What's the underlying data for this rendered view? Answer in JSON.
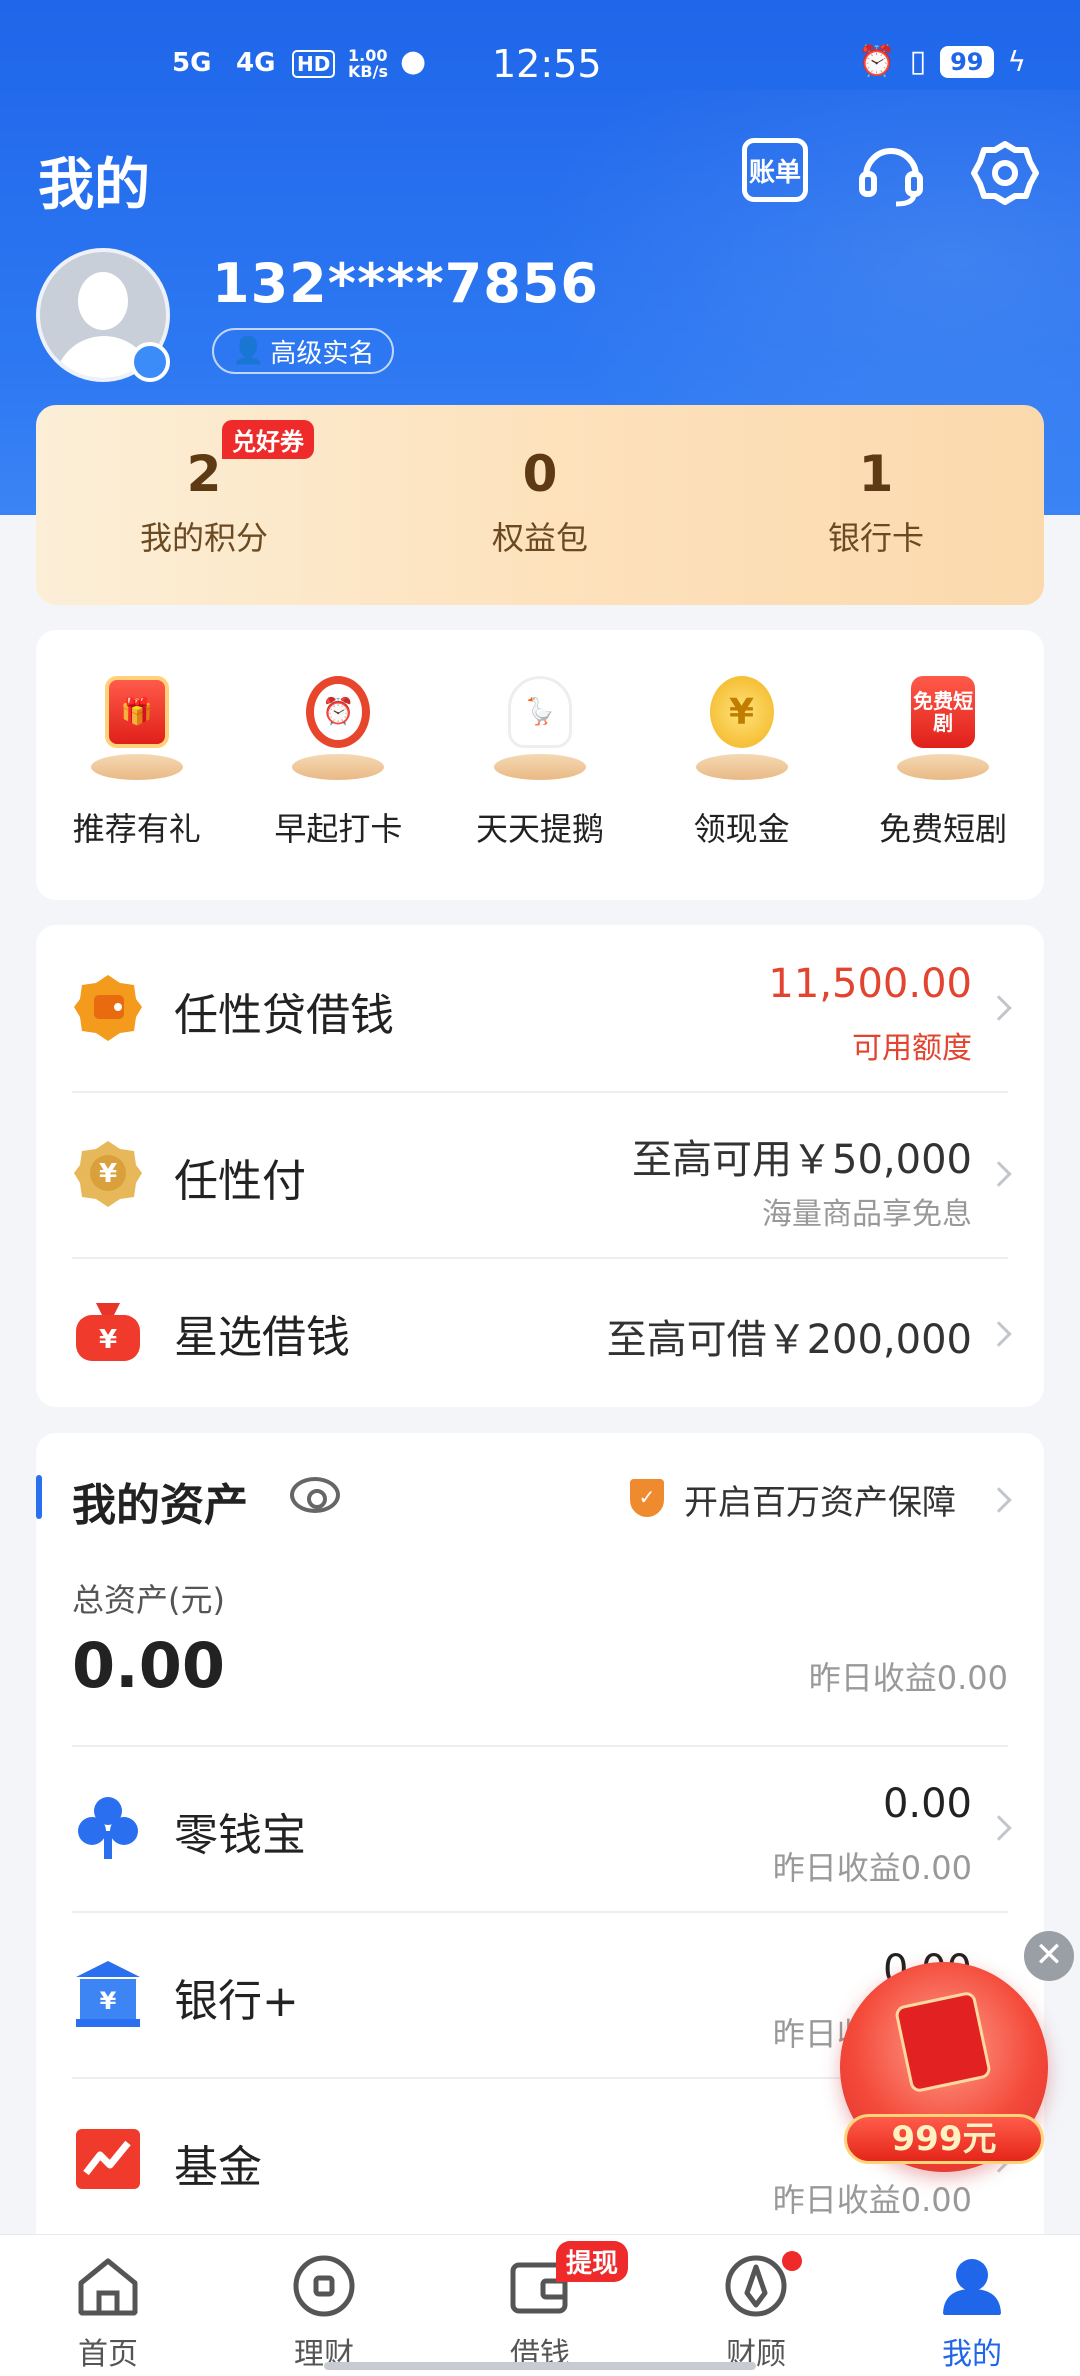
{
  "status_bar": {
    "net1": "5G",
    "net2": "4G",
    "hd": "HD",
    "speed": "1.00 KB/s",
    "time": "12:55",
    "battery": "99"
  },
  "header": {
    "title": "我的",
    "bill_label": "账单"
  },
  "profile": {
    "phone": "132****7856",
    "realname_badge": "高级实名"
  },
  "points_card": {
    "coupon_tag": "兑好券",
    "items": [
      {
        "value": "2",
        "label": "我的积分"
      },
      {
        "value": "0",
        "label": "权益包"
      },
      {
        "value": "1",
        "label": "银行卡"
      }
    ]
  },
  "quick_actions": [
    {
      "label": "推荐有礼",
      "icon": "gift-box-icon"
    },
    {
      "label": "早起打卡",
      "icon": "alarm-clock-icon"
    },
    {
      "label": "天天提鹅",
      "icon": "goose-icon"
    },
    {
      "label": "领现金",
      "icon": "gold-coin-icon"
    },
    {
      "label": "免费短剧",
      "icon": "short-drama-icon",
      "text": "免费短剧"
    }
  ],
  "loans": [
    {
      "name": "任性贷借钱",
      "value": "11,500.00",
      "sub": "可用额度"
    },
    {
      "name": "任性付",
      "value": "至高可用￥50,000",
      "sub": "海量商品享免息"
    },
    {
      "name": "星选借钱",
      "value": "至高可借￥200,000"
    }
  ],
  "assets": {
    "title": "我的资产",
    "guard_text": "开启百万资产保障",
    "total_label": "总资产(元)",
    "total_value": "0.00",
    "total_yesterday": "昨日收益0.00",
    "items": [
      {
        "name": "零钱宝",
        "value": "0.00",
        "yesterday": "昨日收益0.00"
      },
      {
        "name": "银行+",
        "value": "0.00",
        "yesterday": "昨日收益0.00"
      },
      {
        "name": "基金",
        "value": "",
        "yesterday": "昨日收益0.00"
      }
    ]
  },
  "promo": {
    "amount": "999元",
    "close": "✕"
  },
  "tabs": [
    {
      "label": "首页"
    },
    {
      "label": "理财"
    },
    {
      "label": "借钱",
      "badge": "提现"
    },
    {
      "label": "财顾"
    },
    {
      "label": "我的"
    }
  ],
  "colors": {
    "brand_blue": "#1f66ea",
    "loan_red": "#e2442f",
    "badge_red": "#ee2a2a",
    "gold": "#5d3a13"
  }
}
